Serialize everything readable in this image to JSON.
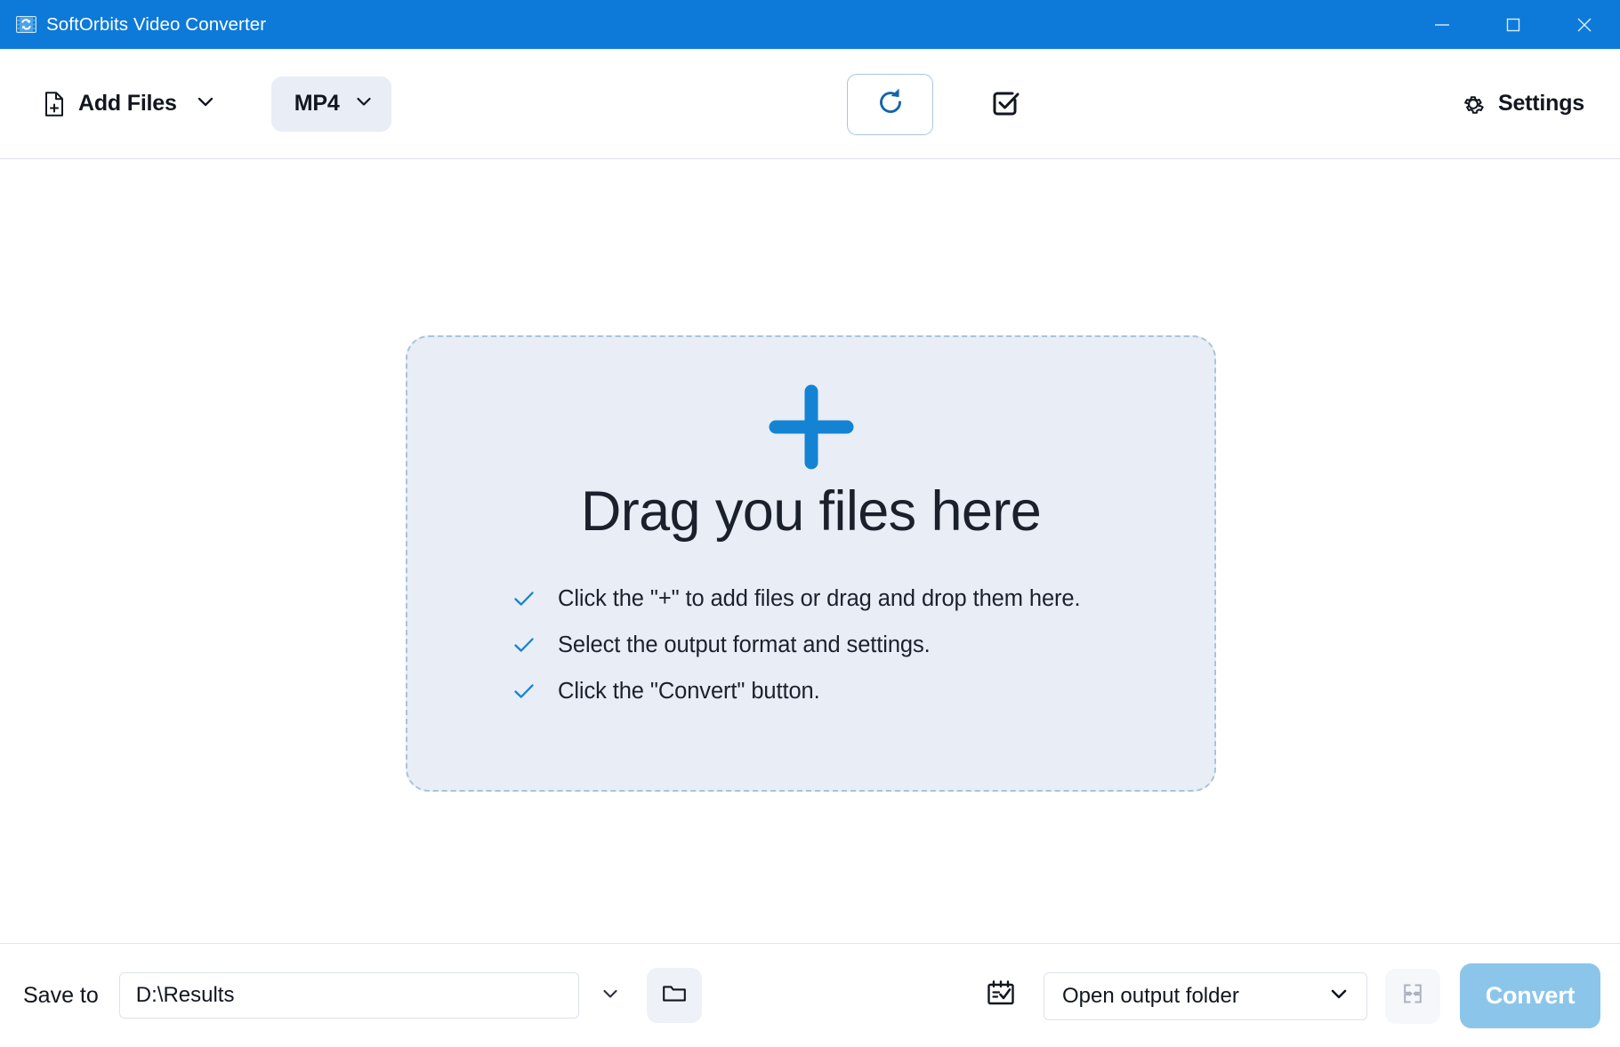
{
  "window": {
    "title": "SoftOrbits Video Converter",
    "app_icon": "film-convert-icon",
    "controls": {
      "minimize": "minimize-icon",
      "maximize": "maximize-icon",
      "close": "close-icon"
    },
    "titlebar_color": "#0d7ad9"
  },
  "toolbar": {
    "add_files_label": "Add Files",
    "add_files_icon": "file-plus-icon",
    "add_files_caret_icon": "chevron-down-icon",
    "format_label": "MP4",
    "format_caret_icon": "chevron-down-icon",
    "refresh_icon": "refresh-icon",
    "select_all_icon": "checkbox-checked-icon",
    "settings_label": "Settings",
    "settings_icon": "gear-icon",
    "refresh_color": "#1565a8"
  },
  "dropzone": {
    "plus_icon": "plus-icon",
    "plus_color": "#1583d4",
    "title": "Drag you files here",
    "background": "#e9edf5",
    "border_color": "#a8c5d8",
    "check_icon": "check-icon",
    "check_color": "#1583d4",
    "items": [
      {
        "text": "Click the \"+\" to add files or drag and drop them here."
      },
      {
        "text": "Select the output format and settings."
      },
      {
        "text": "Click the \"Convert\" button."
      }
    ]
  },
  "bottombar": {
    "save_to_label": "Save to",
    "path_value": "D:\\Results",
    "path_placeholder": "D:\\Results",
    "path_caret_icon": "chevron-down-icon",
    "folder_icon": "folder-icon",
    "schedule_icon": "calendar-check-icon",
    "after_convert_value": "Open output folder",
    "after_convert_caret_icon": "chevron-down-icon",
    "merge_icon": "merge-panels-icon",
    "convert_label": "Convert",
    "convert_color": "#8cc5ea"
  }
}
